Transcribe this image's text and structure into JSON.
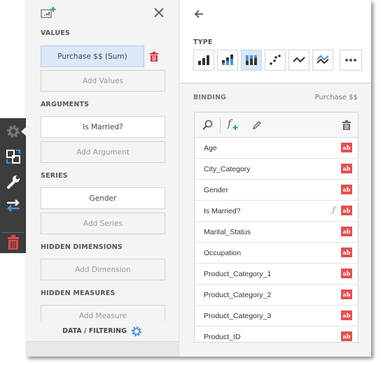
{
  "left_panel": {
    "sections": {
      "values": "VALUES",
      "arguments": "ARGUMENTS",
      "series": "SERIES",
      "hidden_dimensions": "HIDDEN DIMENSIONS",
      "hidden_measures": "HIDDEN MEASURES"
    },
    "values_item": "Purchase $$ (Sum)",
    "add_values": "Add Values",
    "arguments_item": "Is Married?",
    "add_argument": "Add Argument",
    "series_item": "Gender",
    "add_series": "Add Series",
    "add_dimension": "Add Dimension",
    "add_measure": "Add Measure",
    "footer": "DATA / FILTERING"
  },
  "right_panel": {
    "type_label": "TYPE",
    "chart_types": [
      "bar",
      "stacked-bar",
      "full-stacked-bar",
      "point",
      "line",
      "stacked-line",
      "more"
    ],
    "selected_type": "full-stacked-bar",
    "binding_label": "BINDING",
    "binding_target": "Purchase $$",
    "fields": [
      {
        "name": "Age",
        "type": "ab"
      },
      {
        "name": "City_Category",
        "type": "ab"
      },
      {
        "name": "Gender",
        "type": "ab"
      },
      {
        "name": "Is Married?",
        "type": "ab",
        "calculated": true
      },
      {
        "name": "Marital_Status",
        "type": "ab"
      },
      {
        "name": "Occupation",
        "type": "ab"
      },
      {
        "name": "Product_Category_1",
        "type": "ab"
      },
      {
        "name": "Product_Category_2",
        "type": "ab"
      },
      {
        "name": "Product_Category_3",
        "type": "ab"
      },
      {
        "name": "Product_ID",
        "type": "ab"
      }
    ]
  },
  "colors": {
    "accent": "#4a90d9",
    "delete": "#d9283b",
    "add": "#2aa952",
    "toolbar": "#3c3c3c",
    "type_badge": "#e05252"
  }
}
